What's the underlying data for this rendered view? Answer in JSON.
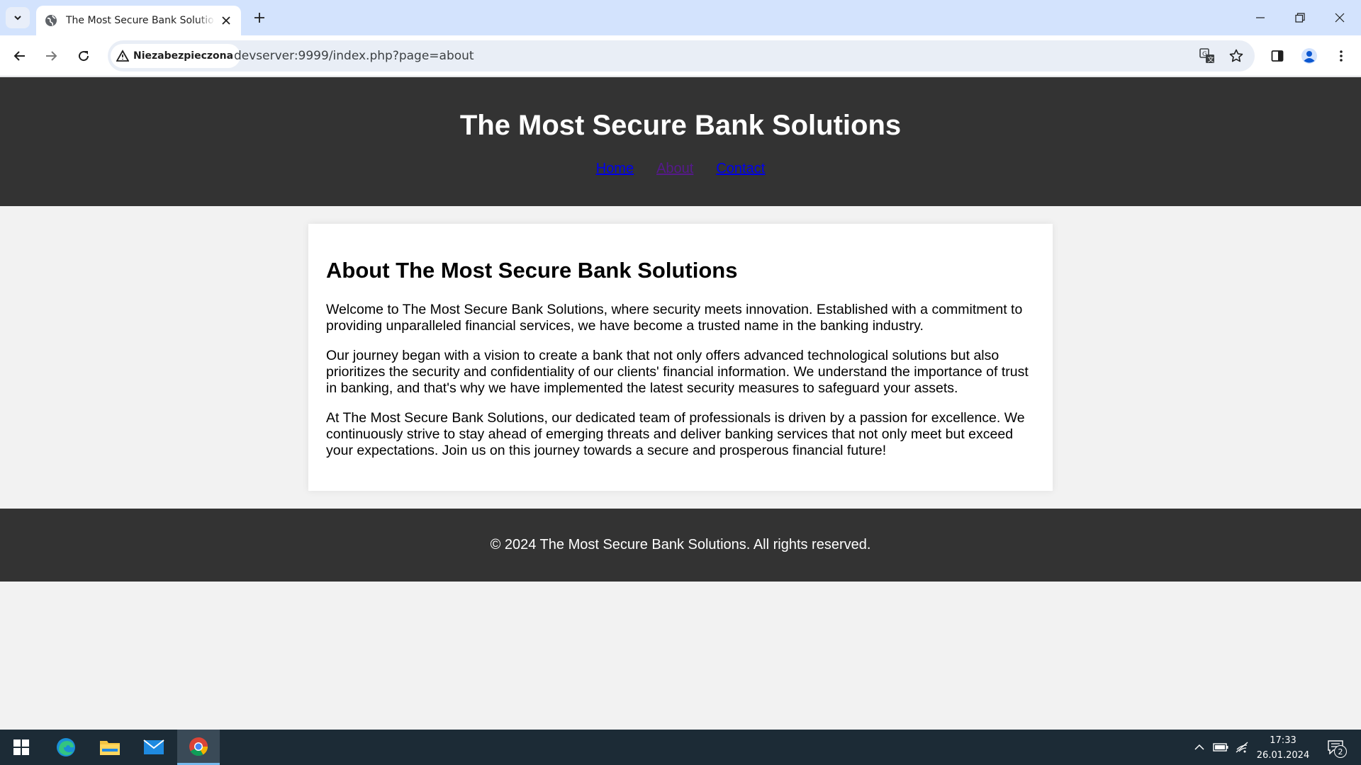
{
  "browser": {
    "tab_title": "The Most Secure Bank Solutions",
    "security_label": "Niezabezpieczona",
    "url": "devserver:9999/index.php?page=about"
  },
  "site": {
    "title": "The Most Secure Bank Solutions",
    "nav": [
      {
        "label": "Home",
        "visited": false
      },
      {
        "label": "About",
        "visited": true
      },
      {
        "label": "Contact",
        "visited": false
      }
    ],
    "about": {
      "heading": "About The Most Secure Bank Solutions",
      "paragraphs": [
        "Welcome to The Most Secure Bank Solutions, where security meets innovation. Established with a commitment to providing unparalleled financial services, we have become a trusted name in the banking industry.",
        "Our journey began with a vision to create a bank that not only offers advanced technological solutions but also prioritizes the security and confidentiality of our clients' financial information. We understand the importance of trust in banking, and that's why we have implemented the latest security measures to safeguard your assets.",
        "At The Most Secure Bank Solutions, our dedicated team of professionals is driven by a passion for excellence. We continuously strive to stay ahead of emerging threats and deliver banking services that not only meet but exceed your expectations. Join us on this journey towards a secure and prosperous financial future!"
      ]
    },
    "footer": "© 2024 The Most Secure Bank Solutions. All rights reserved."
  },
  "taskbar": {
    "time": "17:33",
    "date": "26.01.2024",
    "notification_count": "2"
  },
  "colors": {
    "header_bg": "#333333",
    "link": "#0000ee",
    "link_visited": "#551a8b",
    "tabstrip": "#d3e3fd",
    "taskbar": "#1c2b36"
  }
}
